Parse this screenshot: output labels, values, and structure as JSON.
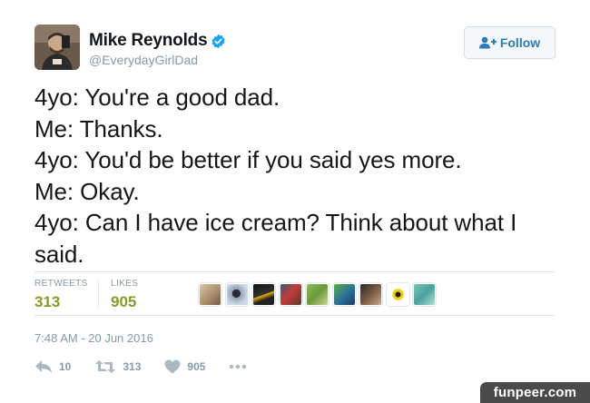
{
  "user": {
    "display_name": "Mike Reynolds",
    "handle": "@EverydayGirlDad",
    "verified": true,
    "avatar_icon": "profile-photo"
  },
  "follow_button": {
    "label": "Follow",
    "icon": "add-user-icon",
    "color": "#2b7bb9"
  },
  "tweet": {
    "lines": [
      "4yo: You're a good dad.",
      "Me: Thanks.",
      "4yo: You'd be better if you said yes more.",
      "Me: Okay.",
      "4yo: Can I have ice cream? Think about what I",
      "said."
    ]
  },
  "stats": {
    "retweets_label": "RETWEETS",
    "retweets_value": "313",
    "likes_label": "LIKES",
    "likes_value": "905",
    "value_color": "#8a9a28"
  },
  "likers": [
    {
      "icon": "liker-avatar-1"
    },
    {
      "icon": "liker-avatar-2"
    },
    {
      "icon": "liker-avatar-3"
    },
    {
      "icon": "liker-avatar-4"
    },
    {
      "icon": "liker-avatar-5"
    },
    {
      "icon": "liker-avatar-6"
    },
    {
      "icon": "liker-avatar-7"
    },
    {
      "icon": "liker-avatar-8"
    },
    {
      "icon": "liker-avatar-9"
    }
  ],
  "timestamp": "7:48 AM - 20 Jun 2016",
  "actions": {
    "reply_count": "10",
    "retweet_count": "313",
    "like_count": "905"
  },
  "watermark": "funpeer.com"
}
